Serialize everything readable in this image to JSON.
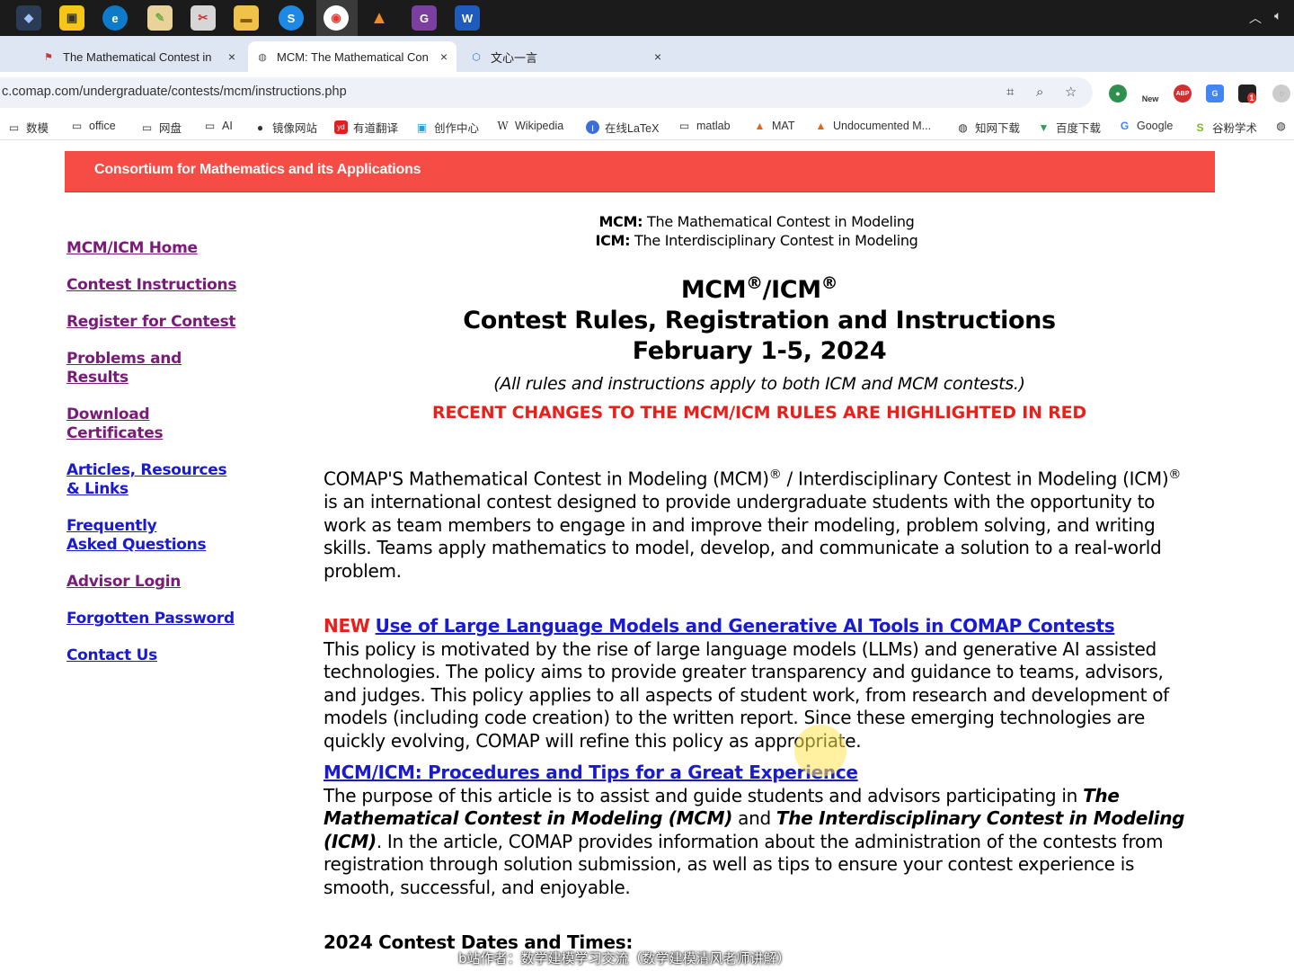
{
  "taskbar": {
    "right_icons": [
      "chevron-up-icon",
      "speaker-icon"
    ]
  },
  "tabs": [
    {
      "title": "The Mathematical Contest in",
      "close": "×"
    },
    {
      "title": "MCM: The Mathematical Con",
      "close": "×"
    },
    {
      "title": "文心一言",
      "close": "×"
    }
  ],
  "new_tab": "+",
  "address": {
    "url": "c.comap.com/undergraduate/contests/mcm/instructions.php"
  },
  "extensions": {
    "new_badge": "New",
    "abp": "ABP",
    "badge_count": "1"
  },
  "bookmarks": [
    {
      "label": "数模",
      "icon": "folder-icon"
    },
    {
      "label": "office",
      "icon": "folder-icon"
    },
    {
      "label": "网盘",
      "icon": "folder-icon"
    },
    {
      "label": "AI",
      "icon": "folder-icon"
    },
    {
      "label": "镜像网站",
      "icon": "github-icon"
    },
    {
      "label": "有道翻译",
      "icon": "youdao-icon"
    },
    {
      "label": "创作中心",
      "icon": "bilibili-icon"
    },
    {
      "label": "Wikipedia",
      "icon": "wikipedia-icon"
    },
    {
      "label": "在线LaTeX",
      "icon": "latex-icon"
    },
    {
      "label": "matlab",
      "icon": "folder-icon"
    },
    {
      "label": "MAT",
      "icon": "matlab-icon"
    },
    {
      "label": "Undocumented M...",
      "icon": "matlab-icon"
    },
    {
      "label": "知网下载",
      "icon": "globe-icon"
    },
    {
      "label": "百度下载",
      "icon": "vue-icon"
    },
    {
      "label": "Google",
      "icon": "google-icon"
    },
    {
      "label": "谷粉学术",
      "icon": "scholar-icon"
    }
  ],
  "banner": {
    "title": "Consortium for Mathematics and its Applications",
    "color": "#f54c45"
  },
  "sidebar": [
    {
      "label": "MCM/ICM Home",
      "color": "purple"
    },
    {
      "label": "Contest Instructions",
      "color": "purple"
    },
    {
      "label": "Register for Contest",
      "color": "purple"
    },
    {
      "label": "Problems and Results",
      "color": "purple"
    },
    {
      "label": "Download Certificates",
      "color": "purple"
    },
    {
      "label": "Articles, Resources & Links",
      "color": "blue"
    },
    {
      "label": "Frequently Asked Questions",
      "color": "blue"
    },
    {
      "label": "Advisor Login",
      "color": "purple"
    },
    {
      "label": "Forgotten Password",
      "color": "blue"
    },
    {
      "label": "Contact Us",
      "color": "blue"
    }
  ],
  "main": {
    "mcm_abbr": "MCM:",
    "mcm_full": " The Mathematical Contest in Modeling",
    "icm_abbr": "ICM:",
    "icm_full": " The Interdisciplinary Contest in Modeling",
    "heading_mcm": "MCM",
    "heading_reg": "®",
    "heading_slash_icm": "/ICM",
    "heading_line2": "Contest Rules, Registration and Instructions",
    "heading_line3": "February 1-5, 2024",
    "note": "(All rules and instructions apply to both ICM and MCM contests.)",
    "red_notice": "RECENT CHANGES TO THE MCM/ICM RULES ARE HIGHLIGHTED IN RED",
    "intro_a": "COMAP'S Mathematical Contest in Modeling (MCM)",
    "intro_b": " / Interdisciplinary Contest in Modeling (ICM)",
    "intro_c": " is an international contest designed to provide undergraduate students with the opportunity to work as team members to engage in and improve their modeling, problem solving, and writing skills. Teams apply mathematics to model, develop, and communicate a solution to a real-world problem.",
    "new_label": "NEW",
    "ai_link": "Use of Large Language Models and Generative AI Tools in COMAP Contests",
    "ai_text": "This policy is motivated by the rise of large language models (LLMs) and generative AI assisted technologies. The policy aims to provide greater transparency and guidance to teams, advisors, and judges. This policy applies to all aspects of student work, from research and development of models (including code creation) to the written report. Since these emerging technologies are quickly evolving, COMAP will refine this policy as appropriate.",
    "tips_link": "MCM/ICM: Procedures and Tips for a Great Experience",
    "tips_text_a": "The purpose of this article is to assist and guide students and advisors participating in ",
    "tips_em1": "The Mathematical Contest in Modeling (MCM)",
    "tips_and": " and ",
    "tips_em2": "The Interdisciplinary Contest in Modeling (ICM)",
    "tips_text_b": ". In the article, COMAP provides information about the administration of the contests from registration through solution submission, as well as tips to ensure your contest experience is smooth, successful, and enjoyable.",
    "dates_heading": "2024 Contest Dates and Times:"
  },
  "watermark": "b站作者：数学建模学习交流（数学建模清风老师讲解）"
}
